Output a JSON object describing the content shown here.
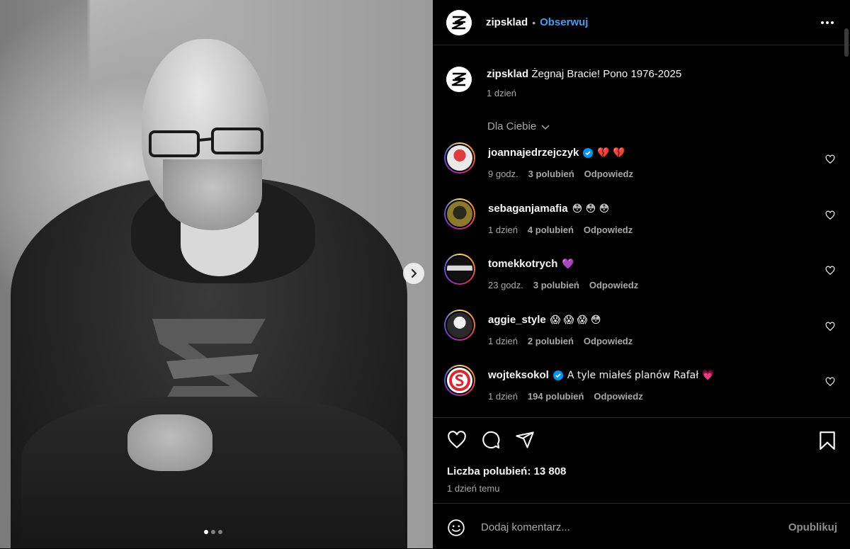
{
  "post": {
    "author": "zipsklad",
    "separator": "•",
    "follow_label": "Obserwuj",
    "caption_user": "zipsklad",
    "caption_text": "Żegnaj Bracie! Pono 1976-2025",
    "caption_time": "1 dzień",
    "filter_label": "Dla Ciebie",
    "likes_text": "Liczba polubień: 13 808",
    "posted_ago": "1 dzień temu",
    "comment_placeholder": "Dodaj komentarz...",
    "publish_label": "Opublikuj",
    "photo_pages": 3,
    "photo_current_page": 1
  },
  "comments": [
    {
      "user": "joannajedrzejczyk",
      "verified": true,
      "text": "💔 💔",
      "time": "9 godz.",
      "likes": "3 polubień",
      "reply": "Odpowiedz"
    },
    {
      "user": "sebaganjamafia",
      "verified": false,
      "text": "😳 😳 😳",
      "time": "1 dzień",
      "likes": "4 polubień",
      "reply": "Odpowiedz"
    },
    {
      "user": "tomekkotrych",
      "verified": false,
      "text": "💜",
      "time": "23 godz.",
      "likes": "3 polubień",
      "reply": "Odpowiedz"
    },
    {
      "user": "aggie_style",
      "verified": false,
      "text": "😱 😱 😱 😳",
      "time": "1 dzień",
      "likes": "2 polubień",
      "reply": "Odpowiedz"
    },
    {
      "user": "wojteksokol",
      "verified": true,
      "text": "A tyle miałeś planów Rafał 💗",
      "time": "1 dzień",
      "likes": "194 polubień",
      "reply": "Odpowiedz"
    }
  ],
  "colors": {
    "accent": "#4a9bf2",
    "background": "#000000",
    "muted": "#a8a8a8"
  },
  "icons": [
    "more-icon",
    "chevron-down-icon",
    "verified-icon",
    "heart-icon",
    "comment-icon",
    "share-icon",
    "bookmark-icon",
    "emoji-icon",
    "chevron-right-icon"
  ]
}
